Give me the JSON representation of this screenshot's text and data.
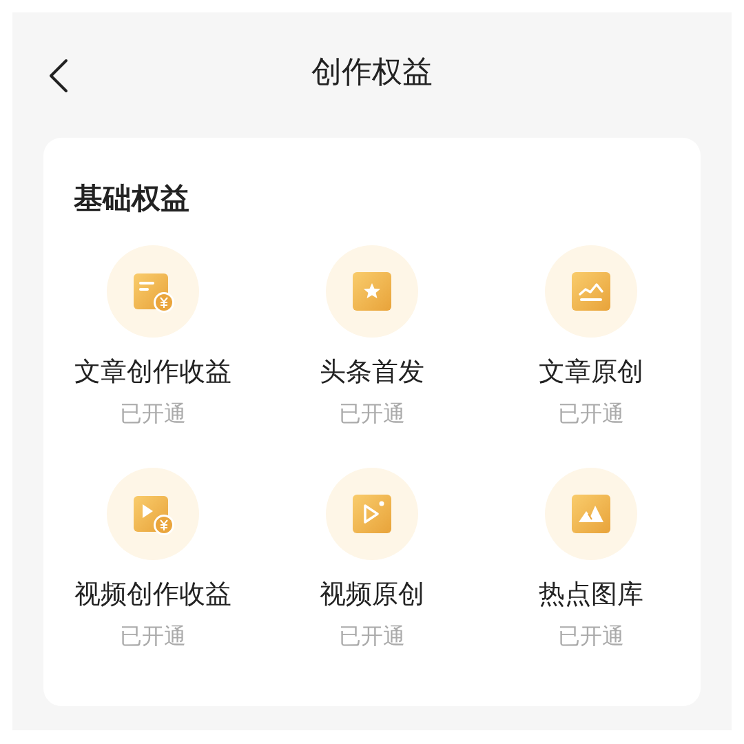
{
  "header": {
    "title": "创作权益"
  },
  "section": {
    "title": "基础权益",
    "items": [
      {
        "kind": "article-income",
        "label": "文章创作收益",
        "status": "已开通"
      },
      {
        "kind": "star",
        "label": "头条首发",
        "status": "已开通"
      },
      {
        "kind": "chart",
        "label": "文章原创",
        "status": "已开通"
      },
      {
        "kind": "video-income",
        "label": "视频创作收益",
        "status": "已开通"
      },
      {
        "kind": "video",
        "label": "视频原创",
        "status": "已开通"
      },
      {
        "kind": "image",
        "label": "热点图库",
        "status": "已开通"
      }
    ]
  }
}
